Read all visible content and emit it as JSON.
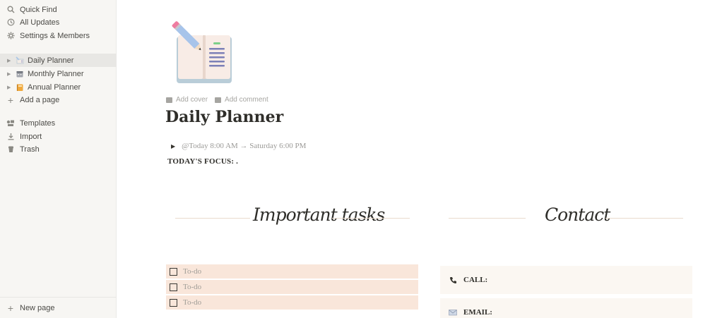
{
  "sidebar": {
    "nav": [
      {
        "icon": "search-icon",
        "glyph": "⚲",
        "label": "Quick Find"
      },
      {
        "icon": "clock-icon",
        "glyph": "◷",
        "label": "All Updates"
      },
      {
        "icon": "gear-icon",
        "glyph": "✲",
        "label": "Settings & Members"
      }
    ],
    "pages": [
      {
        "icon": "planner-page-icon",
        "label": "Daily Planner",
        "active": true
      },
      {
        "icon": "calendar-page-icon",
        "label": "Monthly Planner",
        "active": false
      },
      {
        "icon": "notebook-page-icon",
        "label": "Annual Planner",
        "active": false
      }
    ],
    "add_page": "Add a page",
    "tools": [
      {
        "icon": "templates-icon",
        "glyph": "⧉",
        "label": "Templates"
      },
      {
        "icon": "import-icon",
        "glyph": "⤓",
        "label": "Import"
      },
      {
        "icon": "trash-icon",
        "glyph": "▣",
        "label": "Trash"
      }
    ],
    "new_page": "New page"
  },
  "page": {
    "add_cover": "Add cover",
    "add_comment": "Add comment",
    "title": "Daily Planner",
    "date_range": "@Today 8:00 AM → Saturday 6:00 PM",
    "focus": "TODAY'S FOCUS: ."
  },
  "sections": {
    "tasks_heading": "Important tasks",
    "contact_heading": "Contact"
  },
  "todos": [
    {
      "placeholder": "To-do",
      "checked": false
    },
    {
      "placeholder": "To-do",
      "checked": false
    },
    {
      "placeholder": "To-do",
      "checked": false
    }
  ],
  "contact": {
    "call_label": "CALL:",
    "email_label": "EMAIL:"
  },
  "colors": {
    "todo_bg": "#f9e6da",
    "contact_bg": "#fbf7f2",
    "divider": "#eadbcd"
  }
}
